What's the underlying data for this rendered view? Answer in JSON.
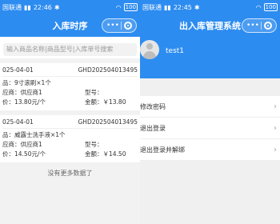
{
  "left": {
    "status": {
      "carrier": "国联通",
      "time": "22:46",
      "battery": "100"
    },
    "nav": {
      "title": "入库时序"
    },
    "search": {
      "placeholder": "输入商品名称|商品型号|入库单号搜索"
    },
    "records": [
      {
        "date": "025-04-01",
        "order_no": "GHD202504013495",
        "product": "品：9寸滚刷×1个",
        "supplier": "应商：供应商1",
        "model": "型号：",
        "price": "价：13.80元/个",
        "amount": "金额：￥13.80"
      },
      {
        "date": "025-04-01",
        "order_no": "GHD202504013495",
        "product": "品：威露士洗手液×1个",
        "supplier": "应商：供应商1",
        "model": "型号：",
        "price": "价：14.50元/个",
        "amount": "金额：￥14.50"
      }
    ],
    "no_more": "没有更多数据了"
  },
  "right": {
    "status": {
      "carrier": "国联通",
      "time": "22:45",
      "battery": "100"
    },
    "nav": {
      "title": "出入库管理系统"
    },
    "user": {
      "name": "test1"
    },
    "menu": [
      {
        "label": "修改密码"
      },
      {
        "label": "退出登录"
      },
      {
        "label": "退出登录并解绑"
      }
    ]
  },
  "colors": {
    "brand": "#2d8cf0",
    "background": "#f2f2f2"
  },
  "icons": [
    "signal-icon",
    "wifi-icon",
    "battery-icon",
    "more-icon",
    "close-capsule-icon",
    "avatar-icon",
    "chevron-right-icon"
  ]
}
